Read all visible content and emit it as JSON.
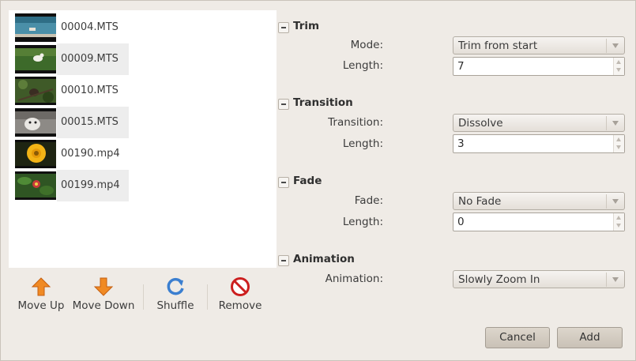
{
  "files": [
    {
      "name": "00004.MTS",
      "thumb": "pool-thumb"
    },
    {
      "name": "00009.MTS",
      "thumb": "grass-bird-thumb"
    },
    {
      "name": "00010.MTS",
      "thumb": "bird-branch-thumb"
    },
    {
      "name": "00015.MTS",
      "thumb": "dog-thumb"
    },
    {
      "name": "00190.mp4",
      "thumb": "sunflower-thumb"
    },
    {
      "name": "00199.mp4",
      "thumb": "flower-leaves-thumb"
    }
  ],
  "toolbar": {
    "move_up": "Move Up",
    "move_down": "Move Down",
    "shuffle": "Shuffle",
    "remove": "Remove"
  },
  "trim": {
    "title": "Trim",
    "mode_label": "Mode:",
    "mode_value": "Trim from start",
    "length_label": "Length:",
    "length_value": "7"
  },
  "transition": {
    "title": "Transition",
    "transition_label": "Transition:",
    "transition_value": "Dissolve",
    "length_label": "Length:",
    "length_value": "3"
  },
  "fade": {
    "title": "Fade",
    "fade_label": "Fade:",
    "fade_value": "No Fade",
    "length_label": "Length:",
    "length_value": "0"
  },
  "animation": {
    "title": "Animation",
    "animation_label": "Animation:",
    "animation_value": "Slowly Zoom In"
  },
  "actions": {
    "cancel": "Cancel",
    "add": "Add"
  },
  "colors": {
    "window_bg": "#efebe6",
    "list_alt_row": "#ededed",
    "button_bg": "#d3ccc2"
  }
}
